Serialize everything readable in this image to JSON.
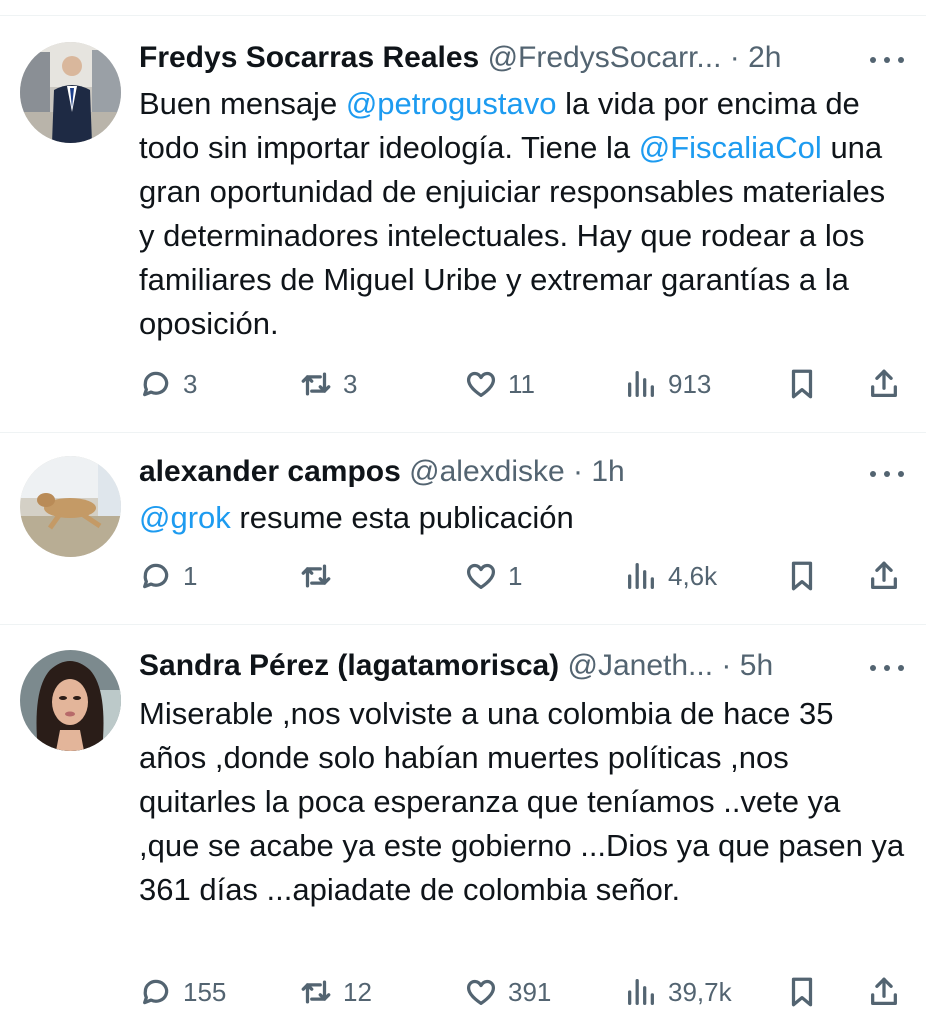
{
  "tweets": [
    {
      "name": "Fredys Socarras Reales",
      "handle": "@FredysSocarr...",
      "dot": "·",
      "time": "2h",
      "segments": [
        {
          "text": "Buen mensaje ",
          "type": "text"
        },
        {
          "text": "@petrogustavo",
          "type": "mention"
        },
        {
          "text": " la vida por encima de todo sin importar ideología. Tiene la ",
          "type": "text"
        },
        {
          "text": "@FiscaliaCol",
          "type": "mention"
        },
        {
          "text": " una gran oportunidad de enjuiciar responsables materiales  y determinadores intelectuales. Hay que rodear a los familiares de Miguel Uribe y extremar garantías a la oposición.",
          "type": "text"
        }
      ],
      "replies": "3",
      "retweets": "3",
      "likes": "11",
      "views": "913"
    },
    {
      "name": "alexander campos",
      "handle": "@alexdiske",
      "dot": "·",
      "time": "1h",
      "segments": [
        {
          "text": "@grok",
          "type": "mention"
        },
        {
          "text": " resume esta publicación",
          "type": "text"
        }
      ],
      "replies": "1",
      "retweets": "",
      "likes": "1",
      "views": "4,6k"
    },
    {
      "name": "Sandra Pérez (lagatamorisca)",
      "handle": "@Janeth...",
      "dot": "·",
      "time": "5h",
      "segments": [
        {
          "text": "Miserable ,nos volviste a una colombia de hace 35 años ,donde solo habían muertes políticas ,nos quitarles la poca esperanza que teníamos ..vete ya ,que se acabe ya este gobierno ...Dios ya que pasen ya 361 días ...apiadate de colombia señor.",
          "type": "text"
        }
      ],
      "replies": "155",
      "retweets": "12",
      "likes": "391",
      "views": "39,7k"
    }
  ],
  "icons": {
    "reply": "reply-icon",
    "retweet": "retweet-icon",
    "like": "heart-icon",
    "views": "views-icon",
    "bookmark": "bookmark-icon",
    "share": "share-icon",
    "more": "more-dots-icon"
  },
  "colors": {
    "mention": "#1d9bf0",
    "secondary": "#536471",
    "text": "#0f1419",
    "divider": "#eff3f4"
  }
}
